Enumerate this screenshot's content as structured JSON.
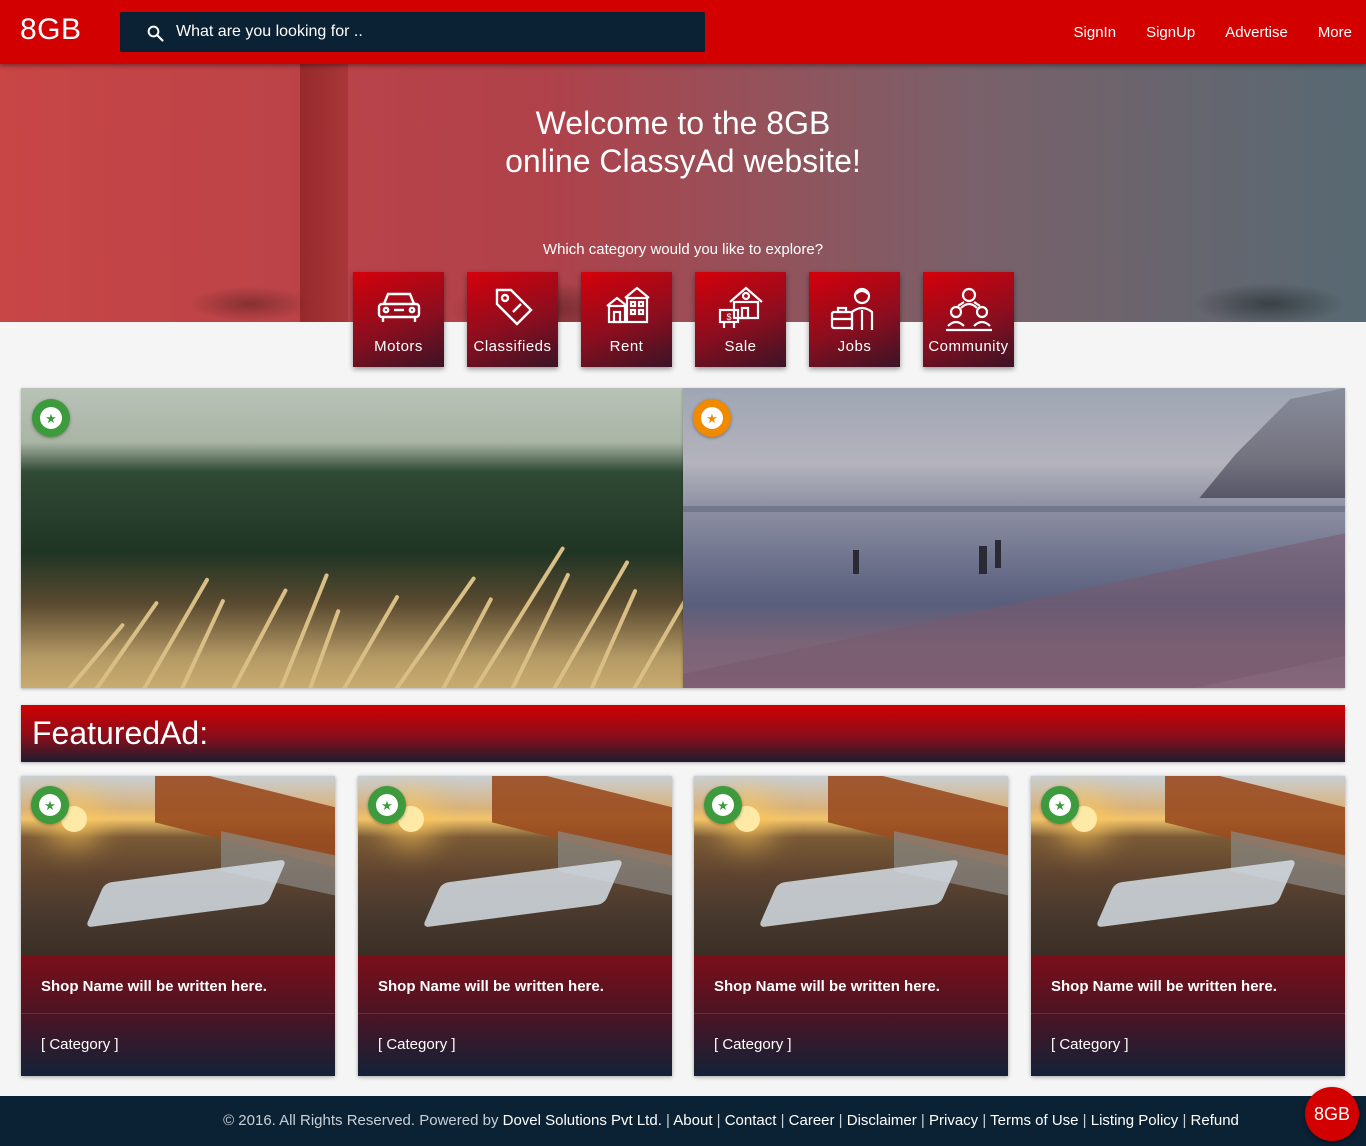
{
  "header": {
    "logo": "8GB",
    "search_placeholder": "What are you looking for ..",
    "nav": [
      "SignIn",
      "SignUp",
      "Advertise",
      "More"
    ]
  },
  "hero": {
    "title_line1": "Welcome to the 8GB",
    "title_line2": "online ClassyAd website!",
    "prompt": "Which category would you like to explore?"
  },
  "categories": [
    {
      "label": "Motors",
      "icon": "car-icon"
    },
    {
      "label": "Classifieds",
      "icon": "tag-icon"
    },
    {
      "label": "Rent",
      "icon": "buildings-icon"
    },
    {
      "label": "Sale",
      "icon": "house-sale-icon"
    },
    {
      "label": "Jobs",
      "icon": "briefcase-person-icon"
    },
    {
      "label": "Community",
      "icon": "people-group-icon"
    }
  ],
  "banners": [
    {
      "icon": "star-icon",
      "badge_color": "#3d9a3d"
    },
    {
      "icon": "star-icon",
      "badge_color": "#f08a00"
    }
  ],
  "featured": {
    "heading": "FeaturedAd:",
    "cards": [
      {
        "shop": "Shop Name will be written here.",
        "category": "[ Category ]"
      },
      {
        "shop": "Shop Name will be written here.",
        "category": "[ Category ]"
      },
      {
        "shop": "Shop Name will be written here.",
        "category": "[ Category ]"
      },
      {
        "shop": "Shop Name will be written here.",
        "category": "[ Category ]"
      }
    ]
  },
  "footer": {
    "copyright": "© 2016. All Rights Reserved. Powered by ",
    "company": "Dovel Solutions Pvt Ltd.",
    "links": [
      "About",
      "Contact",
      "Career",
      "Disclaimer",
      "Privacy",
      "Terms of Use",
      "Listing Policy",
      "Refund"
    ],
    "separator": " | "
  },
  "fab_label": "8GB",
  "colors": {
    "brand_red": "#d30000",
    "navy": "#0b2235"
  }
}
